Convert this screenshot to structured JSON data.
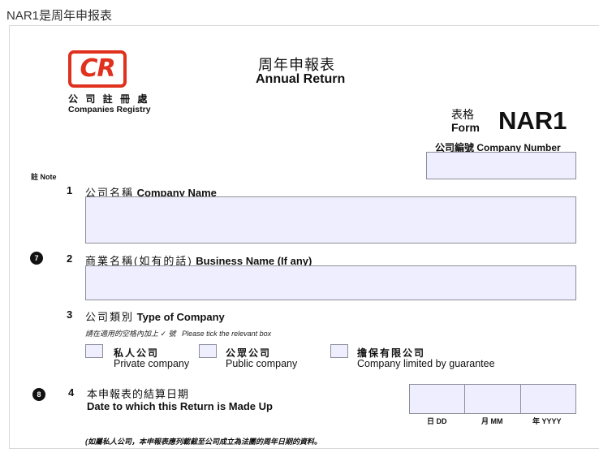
{
  "caption": "NAR1是周年申报表",
  "logo": {
    "mark": "CR",
    "name_zh": "公 司 註 冊 處",
    "name_en": "Companies Registry"
  },
  "title": {
    "zh": "周年申報表",
    "en": "Annual Return"
  },
  "form_id": {
    "label_zh": "表格",
    "label_en": "Form",
    "code": "NAR1"
  },
  "company_number": {
    "label_zh": "公司編號",
    "label_en": "Company Number",
    "value": ""
  },
  "note_label": "註 Note",
  "sections": {
    "s1": {
      "num": "1",
      "label_zh": "公司名稱",
      "label_en": "Company Name",
      "value": ""
    },
    "s2": {
      "num": "2",
      "label_zh": "商業名稱(如有的話)",
      "label_en": "Business Name (If any)",
      "note": "7",
      "value": ""
    },
    "s3": {
      "num": "3",
      "label_zh": "公司類別",
      "label_en": "Type of Company",
      "hint_zh": "請在適用的空格內加上 ✓ 號",
      "hint_en": "Please tick the relevant box",
      "options": [
        {
          "zh": "私人公司",
          "en": "Private company",
          "checked": false
        },
        {
          "zh": "公眾公司",
          "en": "Public company",
          "checked": false
        },
        {
          "zh": "擔保有限公司",
          "en": "Company limited by guarantee",
          "checked": false
        }
      ]
    },
    "s4": {
      "num": "4",
      "label_zh": "本申報表的結算日期",
      "label_en": "Date to which this Return is Made Up",
      "note": "8",
      "date_labels": {
        "day": "日 DD",
        "month": "月 MM",
        "year": "年 YYYY"
      },
      "footnote": "(如屬私人公司，本申報表應列載截至公司成立為法團的周年日期的資料。"
    }
  }
}
